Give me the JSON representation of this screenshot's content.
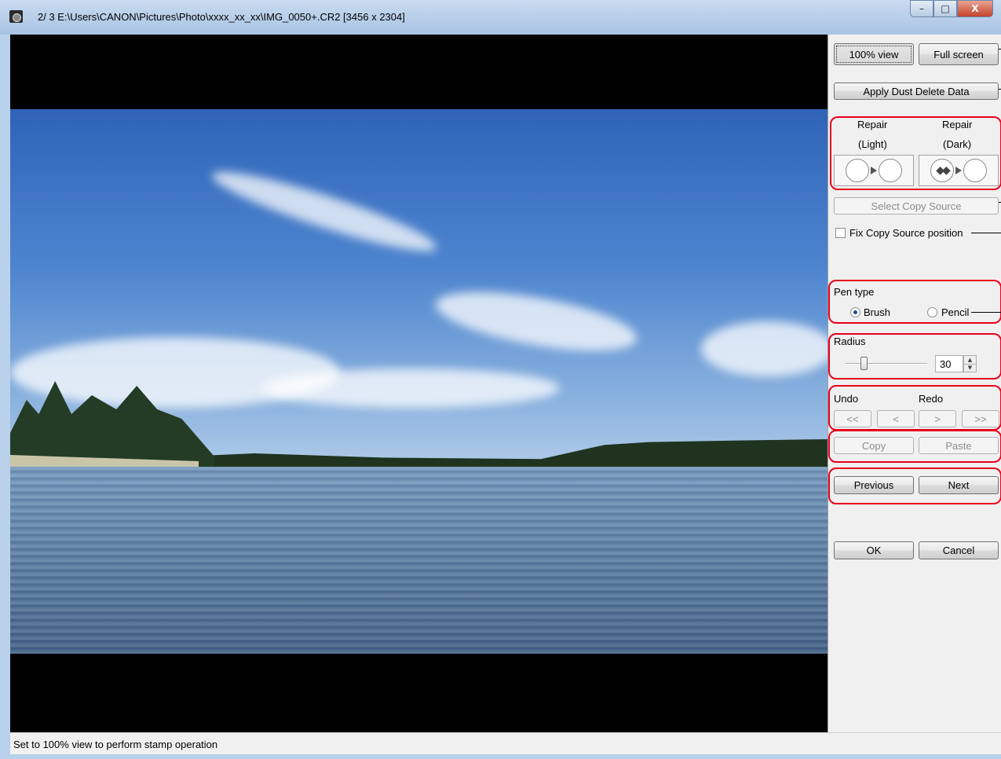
{
  "window": {
    "title": "2/  3  E:\\Users\\CANON\\Pictures\\Photo\\xxxx_xx_xx\\IMG_0050+.CR2 [3456 x 2304]",
    "caption_buttons": {
      "minimize": "–",
      "maximize": "□",
      "close": "X"
    }
  },
  "panel": {
    "view_100": "100% view",
    "full_screen": "Full screen",
    "apply_dust": "Apply Dust Delete Data",
    "repair_light_line1": "Repair",
    "repair_light_line2": "(Light)",
    "repair_dark_line1": "Repair",
    "repair_dark_line2": "(Dark)",
    "select_copy_source": "Select Copy Source",
    "fix_copy_source": "Fix Copy Source position",
    "pen_type_label": "Pen type",
    "pen_brush": "Brush",
    "pen_pencil": "Pencil",
    "pen_selected": "Brush",
    "radius_label": "Radius",
    "radius_value": "30",
    "radius_level": 0.2,
    "undo_label": "Undo",
    "redo_label": "Redo",
    "undo_all": "<<",
    "undo_one": "<",
    "redo_one": ">",
    "redo_all": ">>",
    "copy": "Copy",
    "paste": "Paste",
    "previous": "Previous",
    "next": "Next",
    "ok": "OK",
    "cancel": "Cancel"
  },
  "status": {
    "text": "Set to 100% view to perform stamp operation"
  },
  "colors": {
    "highlight_box": "#e8001c",
    "titlebar": "#b9d1ea",
    "panel_bg": "#f0f0f0"
  }
}
